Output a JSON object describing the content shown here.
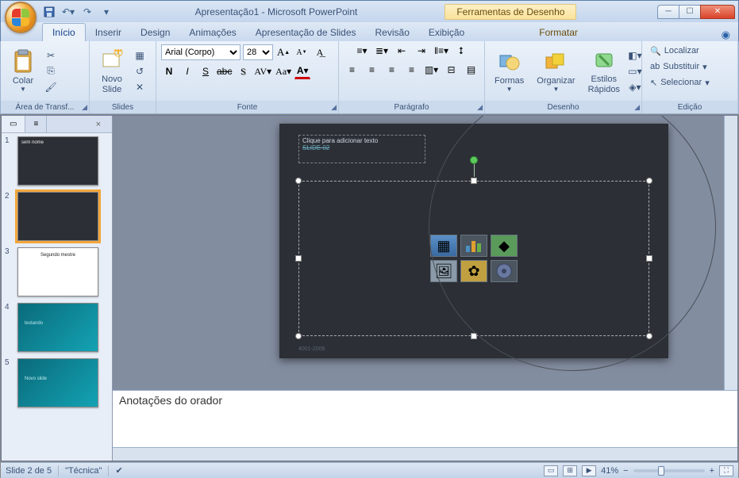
{
  "window": {
    "app_title": "Apresentação1 - Microsoft PowerPoint",
    "tool_context": "Ferramentas de Desenho"
  },
  "qat": {
    "save": "💾",
    "undo": "↶",
    "redo": "↷"
  },
  "tabs": {
    "home": "Início",
    "insert": "Inserir",
    "design": "Design",
    "anim": "Animações",
    "show": "Apresentação de Slides",
    "review": "Revisão",
    "view": "Exibição",
    "format": "Formatar"
  },
  "ribbon": {
    "clipboard": {
      "label": "Área de Transf...",
      "paste": "Colar"
    },
    "slides": {
      "label": "Slides",
      "new_slide": "Novo\nSlide"
    },
    "font": {
      "label": "Fonte",
      "family": "Arial (Corpo)",
      "size": "28"
    },
    "paragraph": {
      "label": "Parágrafo"
    },
    "drawing": {
      "label": "Desenho",
      "shapes": "Formas",
      "arrange": "Organizar",
      "styles": "Estilos\nRápidos"
    },
    "editing": {
      "label": "Edição",
      "find": "Localizar",
      "replace": "Substituir",
      "select": "Selecionar"
    }
  },
  "thumbs": [
    {
      "n": "1",
      "title": "sem nome",
      "theme": "dark"
    },
    {
      "n": "2",
      "title": "",
      "theme": "dark"
    },
    {
      "n": "3",
      "title": "Segundo mestre",
      "theme": "white"
    },
    {
      "n": "4",
      "title": "testando",
      "theme": "teal"
    },
    {
      "n": "5",
      "title": "Novo slide",
      "theme": "teal"
    }
  ],
  "slide": {
    "title_placeholder": "Clique para adicionar texto",
    "subtitle": "SLIDE 02",
    "footer": "4001-2006"
  },
  "notes": {
    "placeholder": "Anotações do orador"
  },
  "status": {
    "slide_pos": "Slide 2 de 5",
    "theme": "\"Técnica\"",
    "zoom": "41%"
  }
}
